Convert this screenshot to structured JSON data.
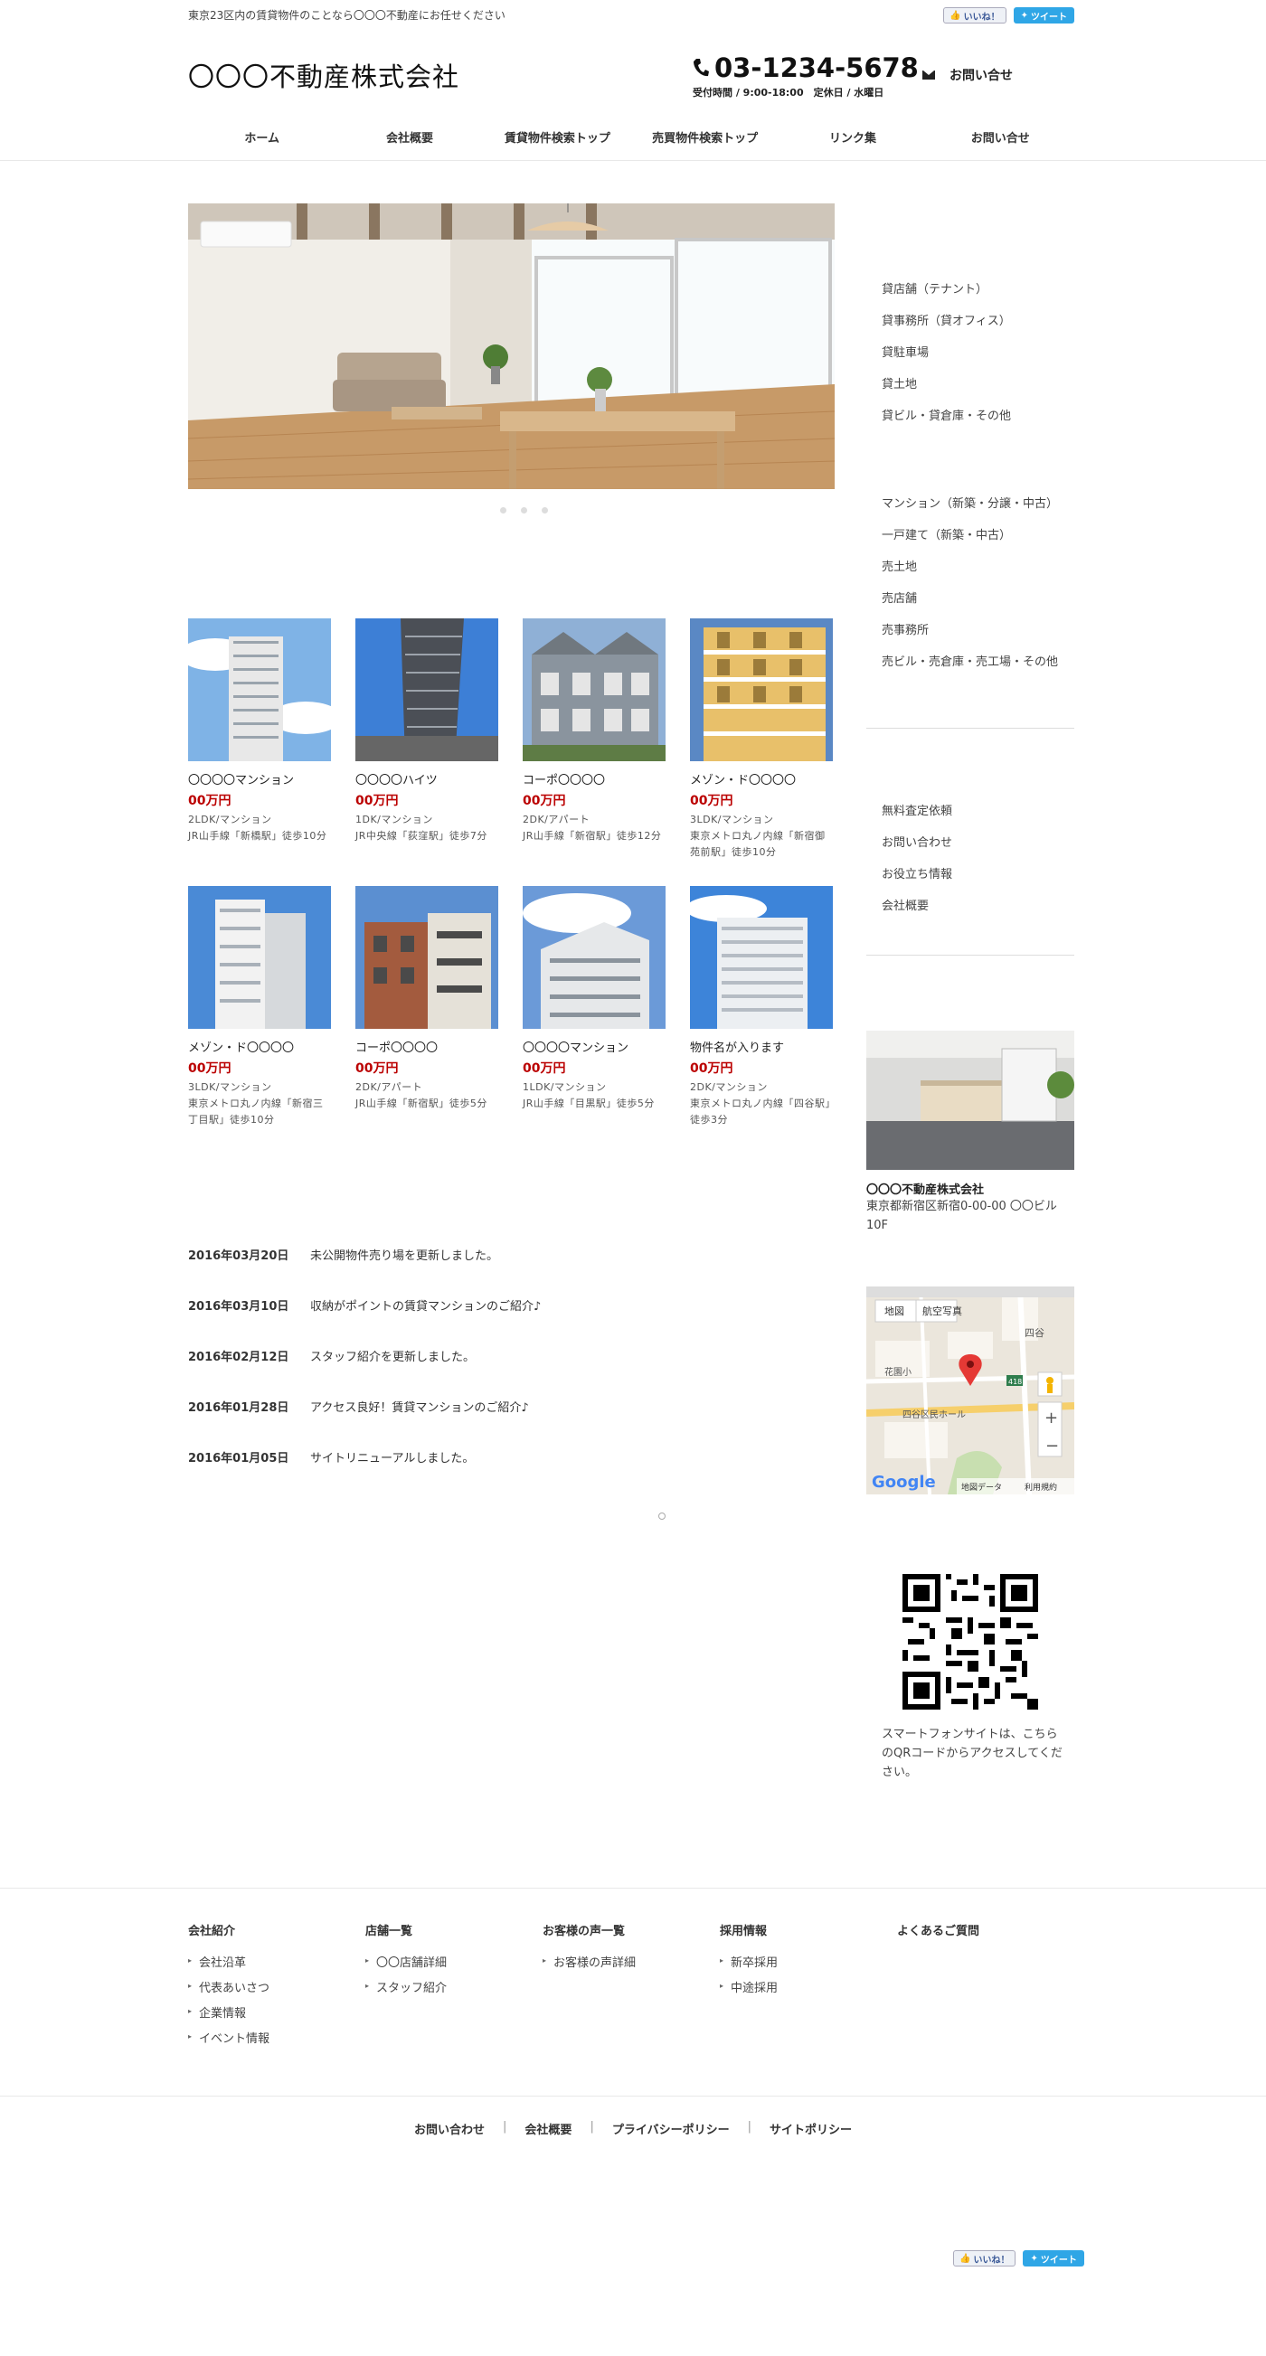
{
  "top": {
    "tagline": "東京23区内の賃貸物件のことなら〇〇〇不動産にお任せください",
    "like_label": "いいね！",
    "tweet_label": "ツイート"
  },
  "header": {
    "logo": "〇〇〇不動産株式会社",
    "tel": "03-1234-5678",
    "hours": "受付時間 / 9:00-18:00　定休日 / 水曜日",
    "contact": "お問い合せ"
  },
  "nav": [
    "ホーム",
    "会社概要",
    "賃貸物件検索トップ",
    "売買物件検索トップ",
    "リンク集",
    "お問い合せ"
  ],
  "properties": [
    {
      "name": "〇〇〇〇マンション",
      "price": "00万円",
      "spec": "2LDK/マンション",
      "access": "JR山手線「新橋駅」徒歩10分"
    },
    {
      "name": "〇〇〇〇ハイツ",
      "price": "00万円",
      "spec": "1DK/マンション",
      "access": "JR中央線「荻窪駅」徒歩7分"
    },
    {
      "name": "コーポ〇〇〇〇",
      "price": "00万円",
      "spec": "2DK/アパート",
      "access": "JR山手線「新宿駅」徒歩12分"
    },
    {
      "name": "メゾン・ド〇〇〇〇",
      "price": "00万円",
      "spec": "3LDK/マンション",
      "access": "東京メトロ丸ノ内線「新宿御苑前駅」徒歩10分"
    },
    {
      "name": "メゾン・ド〇〇〇〇",
      "price": "00万円",
      "spec": "3LDK/マンション",
      "access": "東京メトロ丸ノ内線「新宿三丁目駅」徒歩10分"
    },
    {
      "name": "コーポ〇〇〇〇",
      "price": "00万円",
      "spec": "2DK/アパート",
      "access": "JR山手線「新宿駅」徒歩5分"
    },
    {
      "name": "〇〇〇〇マンション",
      "price": "00万円",
      "spec": "1LDK/マンション",
      "access": "JR山手線「目黒駅」徒歩5分"
    },
    {
      "name": "物件名が入ります",
      "price": "00万円",
      "spec": "2DK/マンション",
      "access": "東京メトロ丸ノ内線「四谷駅」徒歩3分"
    }
  ],
  "news": [
    {
      "date": "2016年03月20日",
      "text": "未公開物件売り場を更新しました。"
    },
    {
      "date": "2016年03月10日",
      "text": "収納がポイントの賃貸マンションのご紹介♪"
    },
    {
      "date": "2016年02月12日",
      "text": "スタッフ紹介を更新しました。"
    },
    {
      "date": "2016年01月28日",
      "text": "アクセス良好！賃貸マンションのご紹介♪"
    },
    {
      "date": "2016年01月05日",
      "text": "サイトリニューアルしました。"
    }
  ],
  "sidebar": {
    "rent": [
      "貸店舗（テナント）",
      "貸事務所（貸オフィス）",
      "貸駐車場",
      "貸土地",
      "貸ビル・貸倉庫・その他"
    ],
    "sale": [
      "マンション（新築・分譲・中古）",
      "一戸建て（新築・中古）",
      "売土地",
      "売店舗",
      "売事務所",
      "売ビル・売倉庫・売工場・その他"
    ],
    "links": [
      "無料査定依頼",
      "お問い合わせ",
      "お役立ち情報",
      "会社概要"
    ],
    "company_name": "〇〇〇不動産株式会社",
    "company_addr": "東京都新宿区新宿0-00-00 〇〇ビル10F",
    "map": {
      "tab_map": "地図",
      "tab_sat": "航空写真",
      "google": "Google",
      "data": "地図データ",
      "terms": "利用規約",
      "place1": "花園小",
      "place2": "四谷区民ホール",
      "place3": "四谷",
      "road": "418"
    },
    "qr_text": "スマートフォンサイトは、こちらのQRコードからアクセスしてください。"
  },
  "footer": {
    "cols": [
      {
        "title": "会社紹介",
        "items": [
          "会社沿革",
          "代表あいさつ",
          "企業情報",
          "イベント情報"
        ]
      },
      {
        "title": "店舗一覧",
        "items": [
          "〇〇店舗詳細",
          "スタッフ紹介"
        ]
      },
      {
        "title": "お客様の声一覧",
        "items": [
          "お客様の声詳細"
        ]
      },
      {
        "title": "採用情報",
        "items": [
          "新卒採用",
          "中途採用"
        ]
      },
      {
        "title": "よくあるご質問",
        "items": []
      }
    ],
    "links": [
      "お問い合わせ",
      "会社概要",
      "プライバシーポリシー",
      "サイトポリシー"
    ]
  },
  "colors": {
    "price": "#bb0000",
    "tweet": "#2fa6e6"
  }
}
